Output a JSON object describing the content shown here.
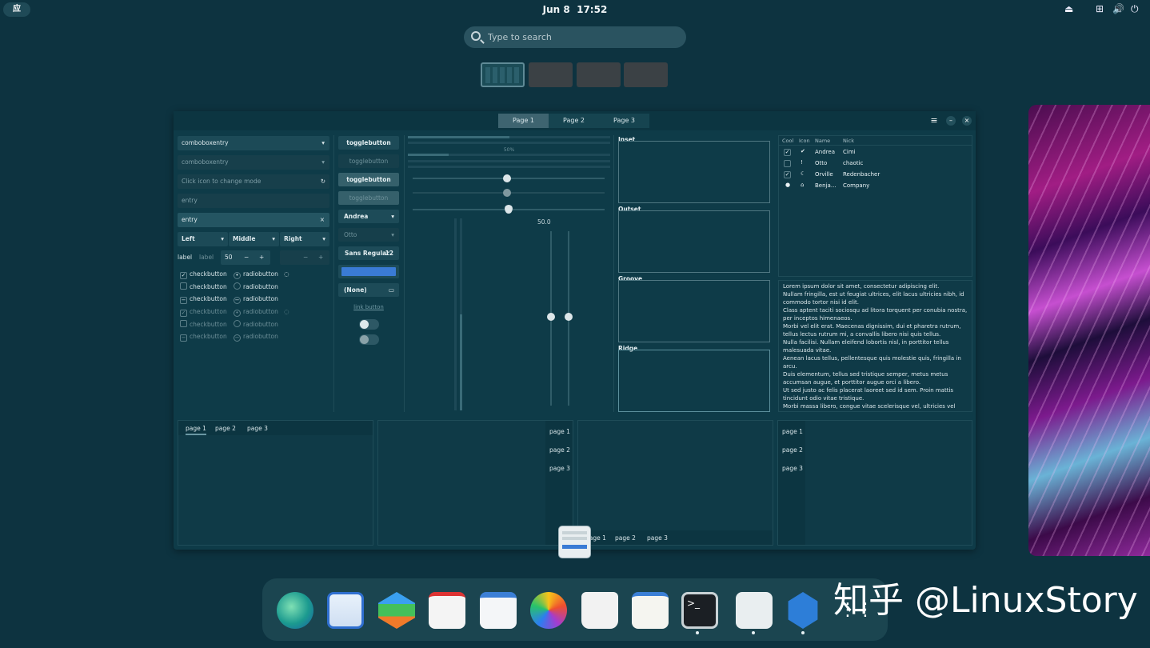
{
  "topbar": {
    "activities": "应",
    "date": "Jun 8",
    "time": "17:52"
  },
  "search": {
    "placeholder": "Type to search"
  },
  "window": {
    "stack_tabs": [
      "Page 1",
      "Page 2",
      "Page 3"
    ],
    "combo1": "comboboxentry",
    "combo2": "comboboxentry",
    "mode_entry": "Click icon to change mode",
    "entry_placeholder": "entry",
    "entry_value": "entry",
    "align": [
      "Left",
      "Middle",
      "Right"
    ],
    "label1": "label",
    "label2": "label",
    "spin_value": "50",
    "checkbutton": "checkbutton",
    "radiobutton": "radiobutton",
    "togglebutton": "togglebutton",
    "combo_andrea": "Andrea",
    "combo_otto": "Otto",
    "font_name": "Sans Regular",
    "font_size": "12",
    "file_none": "(None)",
    "link_button": "link button",
    "progress_text": "50%",
    "scale_value": "50.0",
    "frames": [
      "Inset",
      "Outset",
      "Groove",
      "Ridge"
    ],
    "tree_headers": [
      "Cool",
      "Icon",
      "Name",
      "Nick"
    ],
    "tree_rows": [
      {
        "name": "Andrea",
        "nick": "Cimi"
      },
      {
        "name": "Otto",
        "nick": "chaotic"
      },
      {
        "name": "Orville",
        "nick": "Redenbacher"
      },
      {
        "name": "Benja…",
        "nick": "Company"
      }
    ],
    "lorem": [
      "Lorem ipsum dolor sit amet, consectetur adipiscing elit.",
      "Nullam fringilla, est ut feugiat ultrices, elit lacus ultricies nibh, id commodo tortor nisi id elit.",
      "Class aptent taciti sociosqu ad litora torquent per conubia nostra, per inceptos himenaeos.",
      "Morbi vel elit erat. Maecenas dignissim, dui et pharetra rutrum, tellus lectus rutrum mi, a convallis libero nisi quis tellus.",
      "Nulla facilisi. Nullam eleifend lobortis nisl, in porttitor tellus malesuada vitae.",
      "Aenean lacus tellus, pellentesque quis molestie quis, fringilla in arcu.",
      "Duis elementum, tellus sed tristique semper, metus metus accumsan augue, et porttitor augue orci a libero.",
      "Ut sed justo ac felis placerat laoreet sed id sem. Proin mattis tincidunt odio vitae tristique.",
      "Morbi massa libero, congue vitae scelerisque vel, ultricies vel nisl."
    ],
    "nb_tabs": [
      "page 1",
      "page 2",
      "page 3"
    ]
  },
  "watermark": "知乎 @LinuxStory",
  "colors": {
    "background": "#0d3340",
    "panel": "#0e3b48",
    "accent": "#3a7bd5",
    "dock": "#1b4550"
  }
}
